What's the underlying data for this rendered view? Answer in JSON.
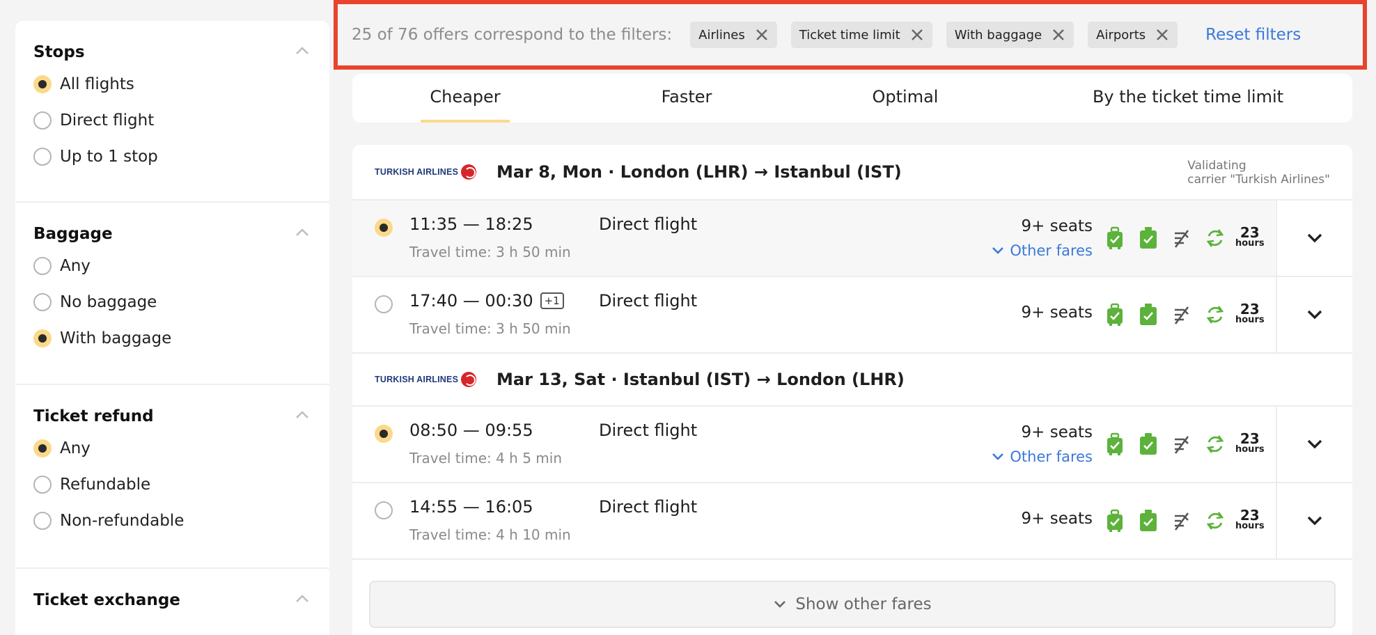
{
  "sidebar": {
    "sections": [
      {
        "title": "Stops",
        "options": [
          {
            "label": "All flights",
            "selected": true
          },
          {
            "label": "Direct flight",
            "selected": false
          },
          {
            "label": "Up to 1 stop",
            "selected": false
          }
        ]
      },
      {
        "title": "Baggage",
        "options": [
          {
            "label": "Any",
            "selected": false
          },
          {
            "label": "No baggage",
            "selected": false
          },
          {
            "label": "With baggage",
            "selected": true
          }
        ]
      },
      {
        "title": "Ticket refund",
        "options": [
          {
            "label": "Any",
            "selected": true
          },
          {
            "label": "Refundable",
            "selected": false
          },
          {
            "label": "Non-refundable",
            "selected": false
          }
        ]
      },
      {
        "title": "Ticket exchange",
        "options": []
      }
    ]
  },
  "filterbar": {
    "count_text": "25 of 76 offers correspond to the filters:",
    "chips": [
      "Airlines",
      "Ticket time limit",
      "With baggage",
      "Airports"
    ],
    "reset_label": "Reset filters"
  },
  "tabs": [
    "Cheaper",
    "Faster",
    "Optimal",
    "By the ticket time limit"
  ],
  "active_tab": "Cheaper",
  "routes": [
    {
      "airline_logo_text": "TURKISH AIRLINES",
      "title": "Mar 8, Mon · London (LHR) → Istanbul (IST)",
      "validating_line1": "Validating",
      "validating_line2": "carrier \"Turkish Airlines\"",
      "flights": [
        {
          "time": "11:35 — 18:25",
          "next_day": "",
          "travel": "Travel time: 3 h 50 min",
          "type": "Direct flight",
          "seats": "9+ seats",
          "other_fares": "Other fares",
          "selected": true,
          "tl_hours": "23",
          "tl_unit": "hours"
        },
        {
          "time": "17:40 — 00:30",
          "next_day": "+1",
          "travel": "Travel time: 3 h 50 min",
          "type": "Direct flight",
          "seats": "9+ seats",
          "other_fares": "",
          "selected": false,
          "tl_hours": "23",
          "tl_unit": "hours"
        }
      ]
    },
    {
      "airline_logo_text": "TURKISH AIRLINES",
      "title": "Mar 13, Sat · Istanbul (IST) → London (LHR)",
      "validating_line1": "",
      "validating_line2": "",
      "flights": [
        {
          "time": "08:50 — 09:55",
          "next_day": "",
          "travel": "Travel time: 4 h 5 min",
          "type": "Direct flight",
          "seats": "9+ seats",
          "other_fares": "Other fares",
          "selected": true,
          "tl_hours": "23",
          "tl_unit": "hours"
        },
        {
          "time": "14:55 — 16:05",
          "next_day": "",
          "travel": "Travel time: 4 h 10 min",
          "type": "Direct flight",
          "seats": "9+ seats",
          "other_fares": "",
          "selected": false,
          "tl_hours": "23",
          "tl_unit": "hours"
        }
      ]
    }
  ],
  "show_other_fares_label": "Show other fares",
  "colors": {
    "accent": "#fbd98a",
    "link": "#3b79d9",
    "green": "#5cb23b",
    "highlight_border": "#e8432c"
  }
}
